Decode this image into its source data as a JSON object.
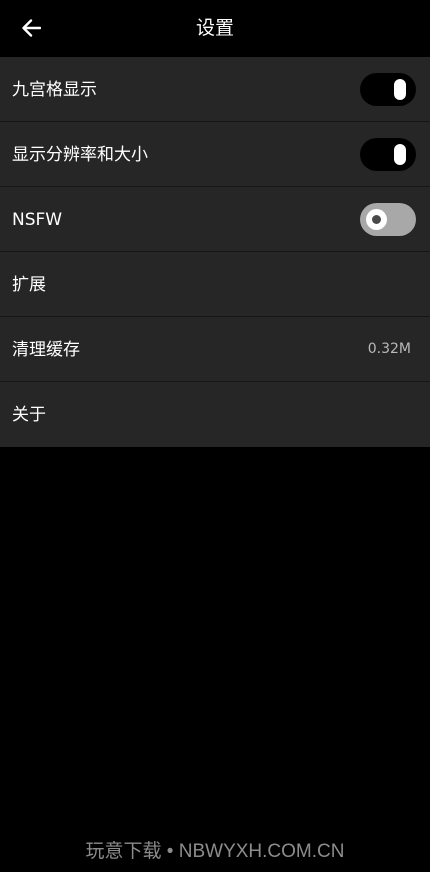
{
  "header": {
    "title": "设置",
    "back_icon": "arrow-left-icon"
  },
  "settings": [
    {
      "label": "九宫格显示",
      "type": "toggle",
      "enabled": true
    },
    {
      "label": "显示分辨率和大小",
      "type": "toggle",
      "enabled": true
    },
    {
      "label": "NSFW",
      "type": "toggle",
      "enabled": false
    },
    {
      "label": "扩展",
      "type": "link"
    },
    {
      "label": "清理缓存",
      "type": "value",
      "value": "0.32M"
    },
    {
      "label": "关于",
      "type": "link"
    }
  ],
  "watermark": "玩意下载 • NBWYXH.COM.CN",
  "colors": {
    "background": "#000000",
    "list_background": "#262626",
    "divider": "#161616",
    "toggle_on_track": "#000000",
    "toggle_off_track": "#a8a8a8",
    "secondary_text": "#b9b9b9"
  }
}
